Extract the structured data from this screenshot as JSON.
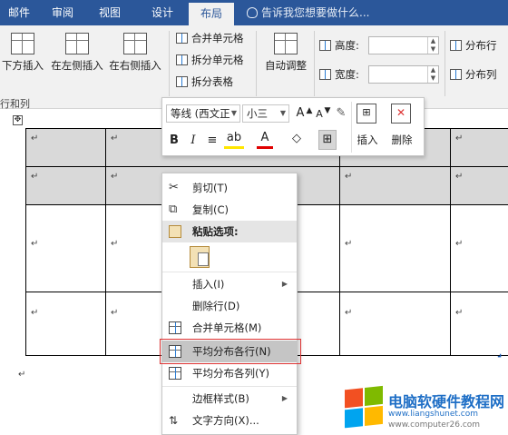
{
  "tabs": [
    {
      "label": "邮件",
      "active": false
    },
    {
      "label": "审阅",
      "active": false
    },
    {
      "label": "视图",
      "active": false
    },
    {
      "label": "设计",
      "active": false
    },
    {
      "label": "布局",
      "active": true
    }
  ],
  "tell_me": "告诉我您想要做什么...",
  "ribbon": {
    "insert_below": "下方插入",
    "insert_left": "在左侧插入",
    "insert_right": "在右侧插入",
    "merge_cells": "合并单元格",
    "split_cells": "拆分单元格",
    "split_table": "拆分表格",
    "autofit": "自动调整",
    "height_label": "高度:",
    "width_label": "宽度:",
    "distribute_rows": "分布行",
    "distribute_cols": "分布列",
    "group_label": "行和列"
  },
  "mini_toolbar": {
    "font": "等线 (西文正",
    "size": "小三",
    "grow": "A",
    "shrink": "A",
    "bold": "B",
    "italic": "I",
    "font_color": "A",
    "insert": "插入",
    "delete": "删除"
  },
  "context_menu": {
    "cut": "剪切(T)",
    "copy": "复制(C)",
    "paste_options": "粘贴选项:",
    "insert": "插入(I)",
    "delete_row": "删除行(D)",
    "merge_cells": "合并单元格(M)",
    "distribute_rows": "平均分布各行(N)",
    "distribute_cols": "平均分布各列(Y)",
    "borders": "边框样式(B)",
    "text_direction": "文字方向(X)..."
  },
  "document": {
    "cell_mark": "↵",
    "table_handle": "✥"
  },
  "watermark": {
    "name": "电脑软硬件教程网",
    "url": "www.liangshunet.com",
    "url2": "www.computer26.com"
  },
  "colors": {
    "ribbon_blue": "#2b579a",
    "highlight_red": "#dd3333",
    "shaded_row": "#d9d9d9"
  }
}
